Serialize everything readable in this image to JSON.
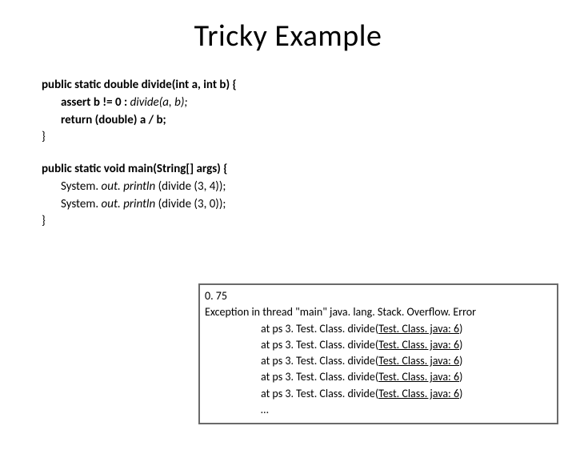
{
  "title": "Tricky Example",
  "code1": {
    "sig": "public static double divide(int a, int b) {",
    "assert_head": "assert b != 0 : ",
    "assert_tail": "divide(a, b);",
    "ret": "return (double) a / b;",
    "close": "}"
  },
  "code2": {
    "sig": "public static void main(String[] args) {",
    "l1a": "System. ",
    "l1b": "out. println ",
    "l1c": "(divide (3, 4));",
    "l2a": "System. ",
    "l2b": "out. println ",
    "l2c": "(divide (3, 0));",
    "close": "}"
  },
  "output": {
    "l1": "0. 75",
    "l2": "Exception in thread \"main\" java. lang. Stack. Overflow. Error",
    "at_prefix": "at ps 3. Test. Class. divide(",
    "at_link": "Test. Class. java: 6",
    "at_suffix": ")",
    "ellipsis": "…"
  }
}
